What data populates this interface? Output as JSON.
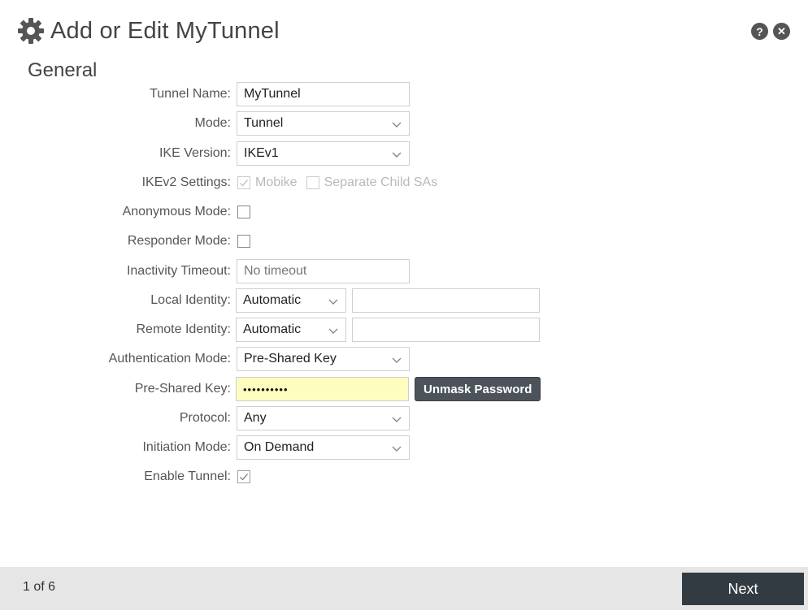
{
  "header": {
    "title": "Add or Edit MyTunnel",
    "icon": "gear-icon",
    "help_icon": "help-icon",
    "close_icon": "close-icon",
    "help_glyph": "?",
    "close_glyph": "✕"
  },
  "section": {
    "title": "General"
  },
  "form": {
    "tunnel_name": {
      "label": "Tunnel Name:",
      "value": "MyTunnel"
    },
    "mode": {
      "label": "Mode:",
      "value": "Tunnel"
    },
    "ike_version": {
      "label": "IKE Version:",
      "value": "IKEv1"
    },
    "ikev2_settings": {
      "label": "IKEv2 Settings:",
      "mobike": {
        "label": "Mobike",
        "checked": true,
        "disabled": true
      },
      "separate_child": {
        "label": "Separate Child SAs",
        "checked": false,
        "disabled": true
      }
    },
    "anonymous_mode": {
      "label": "Anonymous Mode:",
      "checked": false
    },
    "responder_mode": {
      "label": "Responder Mode:",
      "checked": false
    },
    "inactivity_timeout": {
      "label": "Inactivity Timeout:",
      "placeholder": "No timeout"
    },
    "local_identity": {
      "label": "Local Identity:",
      "value": "Automatic",
      "text_value": ""
    },
    "remote_identity": {
      "label": "Remote Identity:",
      "value": "Automatic",
      "text_value": ""
    },
    "authentication_mode": {
      "label": "Authentication Mode:",
      "value": "Pre-Shared Key"
    },
    "pre_shared_key": {
      "label": "Pre-Shared Key:",
      "value": "••••••••••",
      "unmask_label": "Unmask Password"
    },
    "protocol": {
      "label": "Protocol:",
      "value": "Any"
    },
    "initiation_mode": {
      "label": "Initiation Mode:",
      "value": "On Demand"
    },
    "enable_tunnel": {
      "label": "Enable Tunnel:",
      "checked": true
    }
  },
  "footer": {
    "page_indicator": "1 of 6",
    "next_label": "Next"
  },
  "colors": {
    "footer_bg": "#e6e6e6",
    "next_bg": "#333b42",
    "password_bg": "#fdfdc0",
    "unmask_bg": "#4d535a"
  }
}
